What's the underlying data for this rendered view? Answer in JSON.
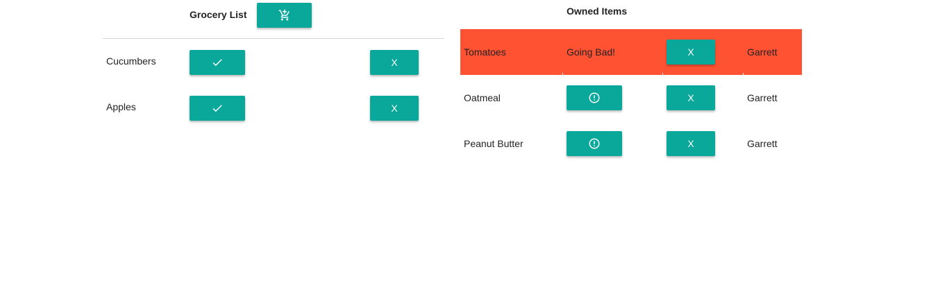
{
  "grocery_list": {
    "title": "Grocery List",
    "add_button_icon": "add-shopping-cart-icon",
    "items": [
      {
        "name": "Cucumbers",
        "check_icon": "check-icon",
        "remove_label": "X"
      },
      {
        "name": "Apples",
        "check_icon": "check-icon",
        "remove_label": "X"
      }
    ]
  },
  "owned_items": {
    "title": "Owned Items",
    "items": [
      {
        "name": "Tomatoes",
        "status": "Going Bad!",
        "remove_label": "X",
        "owner": "Garrett",
        "highlight_color": "#ff5233"
      },
      {
        "name": "Oatmeal",
        "alert_icon": "alert-circle-icon",
        "remove_label": "X",
        "owner": "Garrett"
      },
      {
        "name": "Peanut Butter",
        "alert_icon": "alert-circle-icon",
        "remove_label": "X",
        "owner": "Garrett"
      }
    ]
  },
  "colors": {
    "button": "#0aa89a",
    "warning_row": "#ff5233",
    "divider": "#d4d4d4"
  }
}
